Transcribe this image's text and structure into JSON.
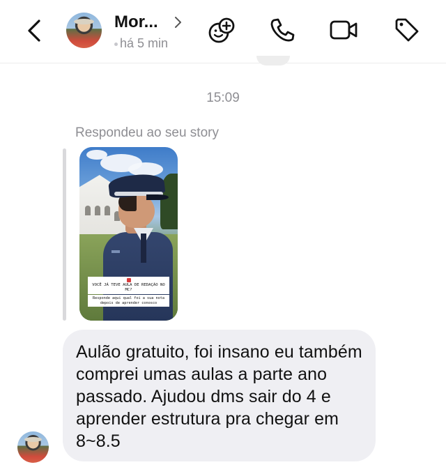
{
  "header": {
    "contact_name": "Mor...",
    "status": "há 5 min",
    "icons": [
      "back-arrow-icon",
      "sticker-icon",
      "phone-icon",
      "video-camera-icon",
      "tag-icon"
    ]
  },
  "conversation": {
    "timestamp": "15:09",
    "reply_label": "Respondeu ao seu story",
    "story": {
      "overlay_question": "VOCÊ JÁ TEVE AULA DE REDAÇÃO NO MC?",
      "overlay_answer": "Responde aqui qual foi a sua nota depois de aprender conosco"
    },
    "message_text": "Aulão gratuito, foi insano eu também comprei umas aulas a parte ano passado. Ajudou dms sair do 4 e aprender estrutura pra chegar em 8~8.5"
  },
  "colors": {
    "bubble_background": "#efeff3",
    "secondary_text": "#8e8e93",
    "icon_color": "#111111"
  }
}
